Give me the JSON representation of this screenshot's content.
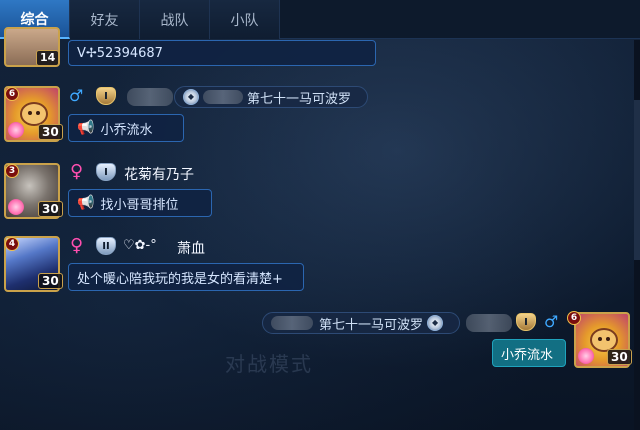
{
  "tabs": [
    {
      "label": "综合",
      "active": true
    },
    {
      "label": "好友",
      "active": false
    },
    {
      "label": "战队",
      "active": false
    },
    {
      "label": "小队",
      "active": false
    }
  ],
  "background": {
    "caption": "对战模式"
  },
  "messages": [
    {
      "id": "m0",
      "avatar_level": "14",
      "text": "V✢52394687"
    },
    {
      "id": "m1",
      "badge": "6",
      "level": "30",
      "gender": "♂",
      "rank": "I",
      "title": "第七十一马可波罗",
      "text": "小乔流水",
      "horn": "📢"
    },
    {
      "id": "m2",
      "badge": "3",
      "level": "30",
      "gender": "♀",
      "rank": "I",
      "name": "花菊有乃子",
      "text": "找小哥哥排位",
      "horn": "📢"
    },
    {
      "id": "m3",
      "badge": "4",
      "level": "30",
      "gender": "♀",
      "rank": "II",
      "name_prefix": "♡✿-°",
      "name": "萧血",
      "text": "处个暖心陪我玩的我是女的看清楚+"
    },
    {
      "id": "m4",
      "mine": true,
      "badge": "6",
      "level": "30",
      "gender": "♂",
      "rank": "I",
      "title": "第七十一马可波罗",
      "text": "小乔流水"
    }
  ],
  "colors": {
    "tab_active": "#2f78c4",
    "male": "#3fa9ff",
    "female": "#ff4fb0",
    "my_bubble": "#126f83",
    "bubble_border": "#2b66b0"
  }
}
